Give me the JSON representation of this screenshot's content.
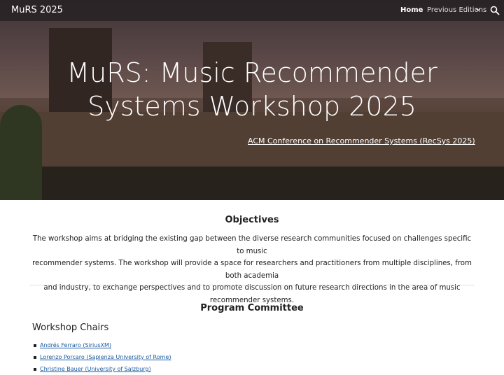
{
  "header": {
    "site_title": "MuRS 2025",
    "nav": {
      "home": "Home",
      "previous_editions": "Previous Editions"
    }
  },
  "hero": {
    "title_line1": "MuRS: Music Recommender",
    "title_line2": "Systems Workshop 2025",
    "link": "ACM Conference on Recommender Systems (RecSys 2025)"
  },
  "objectives": {
    "heading": "Objectives",
    "line1": "The workshop aims at bridging the existing gap between the diverse research communities focused on challenges specific to music",
    "line2": "recommender systems. The workshop will provide a space for researchers and practitioners from multiple disciplines, from both academia",
    "line3": "and industry, to exchange perspectives and to promote discussion on future research directions in the area of music recommender systems."
  },
  "committee": {
    "heading": "Program Committee",
    "chairs_heading": "Workshop Chairs",
    "chairs": [
      "Andrés Ferraro (SiriusXM)",
      "Lorenzo Porcaro (Sapienza University of Rome)",
      "Christine Bauer (University of Salzburg)"
    ]
  }
}
